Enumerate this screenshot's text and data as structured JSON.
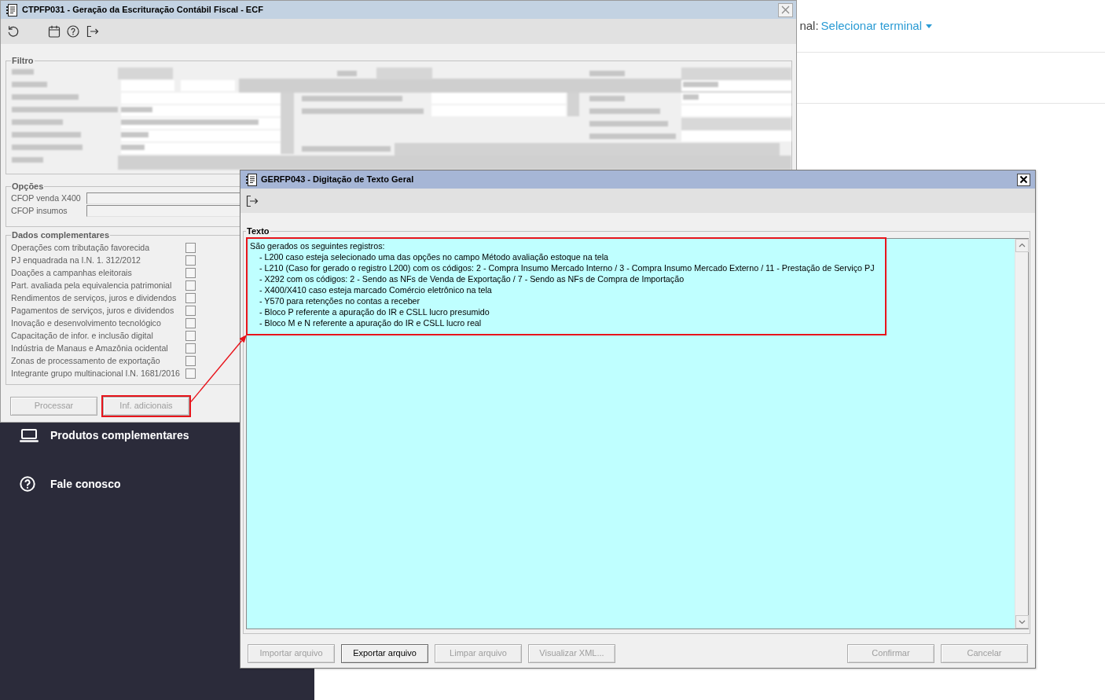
{
  "page": {
    "terminal": {
      "label": "nal:",
      "link": "Selecionar terminal"
    },
    "sidebar": {
      "items": [
        {
          "label": "Produtos complementares",
          "kind": "laptop"
        },
        {
          "label": "Fale conosco",
          "kind": "help"
        }
      ]
    }
  },
  "main_window": {
    "title": "CTPFP031 - Geração da Escrituração Contábil Fiscal - ECF",
    "filter": {
      "legend": "Filtro"
    },
    "options": {
      "legend": "Opções",
      "fields": [
        {
          "label": "CFOP venda X400"
        },
        {
          "label": "CFOP insumos"
        }
      ]
    },
    "complementary_data": {
      "legend": "Dados complementares",
      "items": [
        {
          "label": "Operações com tributação favorecida",
          "checked": false
        },
        {
          "label": "PJ enquadrada na I.N. 1. 312/2012",
          "checked": false
        },
        {
          "label": "Doações a campanhas eleitorais",
          "checked": false
        },
        {
          "label": "Part. avaliada pela equivalencia patrimonial",
          "checked": false
        },
        {
          "label": "Rendimentos de serviços, juros e dividendos",
          "checked": false
        },
        {
          "label": "Pagamentos de serviços, juros e dividendos",
          "checked": false
        },
        {
          "label": "Inovação e desenvolvimento tecnológico",
          "checked": false
        },
        {
          "label": "Capacitação de infor. e inclusão digital",
          "checked": false
        },
        {
          "label": "Indústria de Manaus e Amazônia ocidental",
          "checked": false
        },
        {
          "label": "Zonas de processamento de exportação",
          "checked": false
        },
        {
          "label": "Integrante grupo multinacional I.N. 1681/2016",
          "checked": false
        }
      ]
    },
    "buttons": [
      {
        "label": "Processar",
        "disabled": true,
        "highlighted": false
      },
      {
        "label": "Inf. adicionais",
        "disabled": true,
        "highlighted": true
      }
    ]
  },
  "text_dialog": {
    "title": "GERFP043 - Digitação de Texto Geral",
    "text_section": {
      "legend": "Texto",
      "highlighted": true,
      "lines": [
        {
          "text": "São gerados os seguintes registros:",
          "children": [
            {
              "text": "- L200 caso esteja selecionado uma das opções no campo Método avaliação estoque na tela"
            },
            {
              "text": "- L210 (Caso for gerado o registro L200) com os códigos: 2 - Compra Insumo Mercado Interno / 3 - Compra Insumo Mercado Externo / 11 - Prestação de Serviço PJ"
            },
            {
              "text": "- X292 com os códigos: 2 - Sendo as NFs de Venda de Exportação / 7 - Sendo as NFs de Compra de Importação"
            },
            {
              "text": "- X400/X410 caso esteja marcado Comércio eletrônico na tela"
            },
            {
              "text": "- Y570 para retenções no contas a receber"
            },
            {
              "text": "- Bloco P referente a apuração do IR e CSLL lucro presumido"
            },
            {
              "text": "- Bloco M e N referente a apuração do IR e CSLL lucro real"
            }
          ]
        }
      ]
    },
    "file_buttons": [
      {
        "label": "Importar arquivo",
        "disabled": true
      },
      {
        "label": "Exportar arquivo",
        "disabled": false
      },
      {
        "label": "Limpar arquivo",
        "disabled": true
      },
      {
        "label": "Visualizar XML...",
        "disabled": true
      }
    ],
    "action_buttons": [
      {
        "label": "Confirmar",
        "disabled": true
      },
      {
        "label": "Cancelar",
        "disabled": true
      }
    ]
  }
}
